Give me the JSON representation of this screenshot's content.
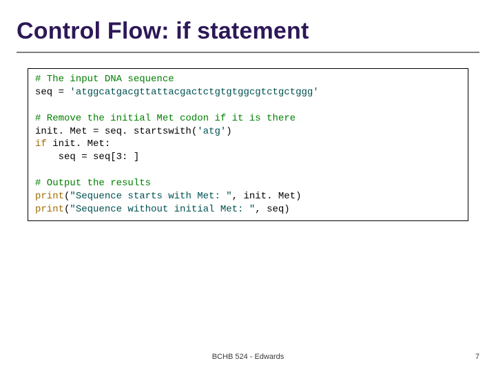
{
  "slide": {
    "title": "Control Flow: if statement",
    "footer": "BCHB 524 - Edwards",
    "page_number": "7"
  },
  "code": {
    "l01": "# The input DNA sequence",
    "l02a": "seq = ",
    "l02b": "'atggcatgacgttattacgactctgtgtggcgtctgctggg'",
    "blank1": "",
    "l03": "# Remove the initial Met codon if it is there",
    "l04a": "init. Met = seq. startswith(",
    "l04b": "'atg'",
    "l04c": ")",
    "l05a": "if",
    "l05b": " init. Met:",
    "l06": "    seq = seq[3: ]",
    "blank2": "",
    "l07": "# Output the results",
    "l08a": "print",
    "l08b": "(",
    "l08c": "\"Sequence starts with Met: \"",
    "l08d": ", init. Met)",
    "l09a": "print",
    "l09b": "(",
    "l09c": "\"Sequence without initial Met: \"",
    "l09d": ", seq)"
  }
}
